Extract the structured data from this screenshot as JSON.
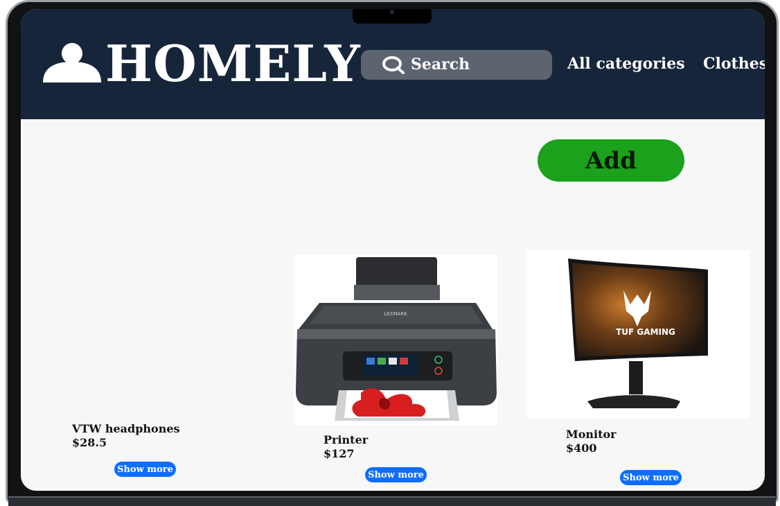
{
  "brand": {
    "name": "HOMELY",
    "logo_icon": "user-icon"
  },
  "search": {
    "placeholder": "Search",
    "icon": "search-icon"
  },
  "nav": {
    "items": [
      {
        "label": "All  categories"
      },
      {
        "label": "Clothes"
      }
    ]
  },
  "actions": {
    "add_label": "Add"
  },
  "products": [
    {
      "name": "VTW headphones",
      "price": "$28.5",
      "button": "Show more",
      "image": "none"
    },
    {
      "name": "Printer",
      "price": "$127",
      "button": "Show more",
      "image": "printer"
    },
    {
      "name": "Monitor",
      "price": "$400",
      "button": "Show more",
      "image": "monitor"
    }
  ],
  "colors": {
    "header_bg": "#17253b",
    "page_bg": "#f7f7f7",
    "add_button": "#1ba11b",
    "show_more_button": "#0d6efd"
  }
}
